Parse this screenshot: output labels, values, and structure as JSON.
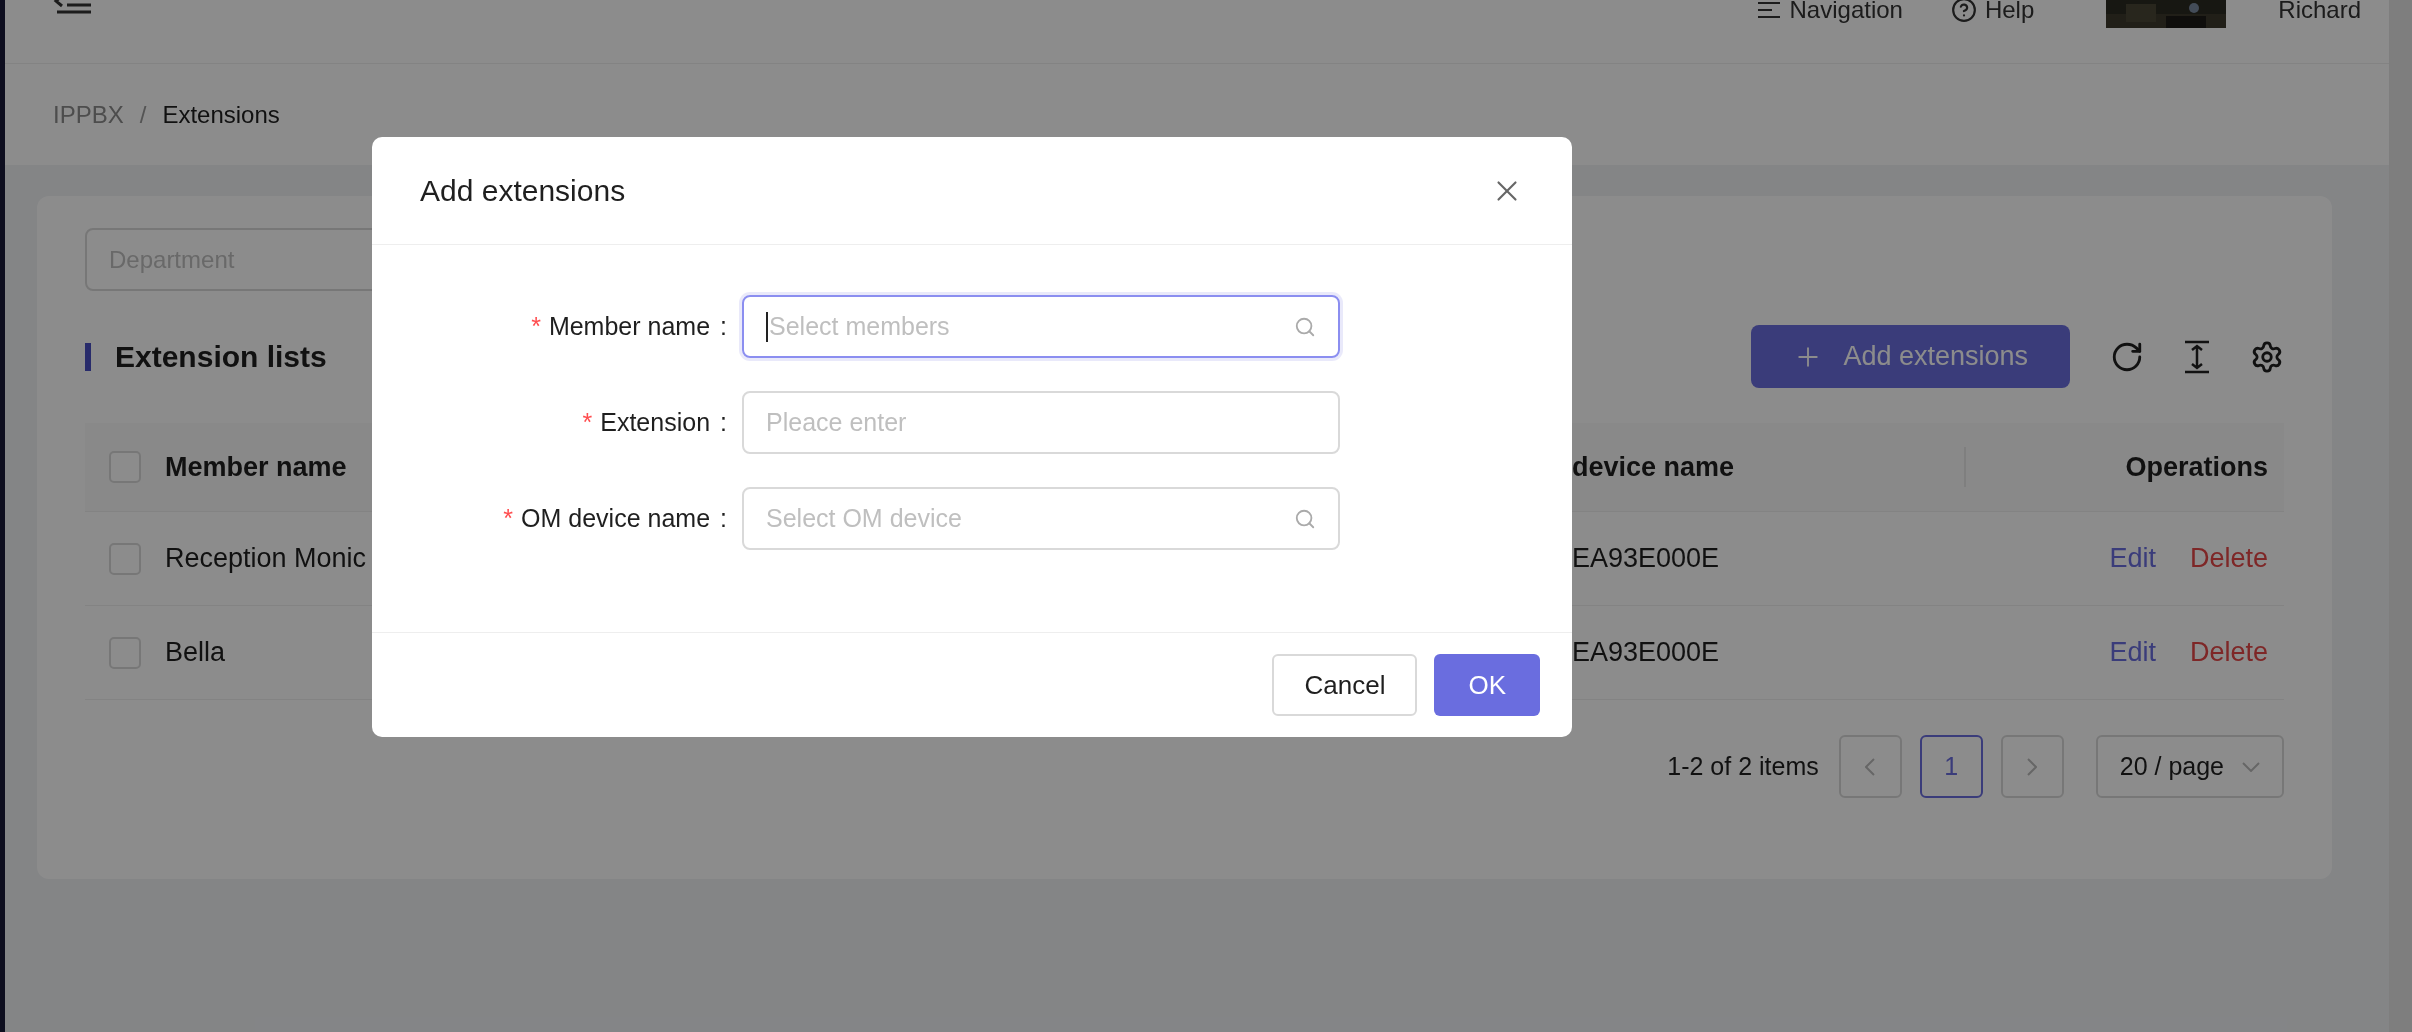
{
  "header": {
    "links": [
      "Navigation",
      "Help"
    ],
    "user": {
      "name": "Richard"
    }
  },
  "breadcrumb": {
    "separator": "/",
    "items": [
      {
        "label": "IPPBX",
        "current": false
      },
      {
        "label": "Extensions",
        "current": true
      }
    ]
  },
  "filters": {
    "department": {
      "placeholder": "Department"
    }
  },
  "section_title": "Extension lists",
  "toolbar": {
    "add_button": "Add extensions"
  },
  "table": {
    "header_checked": false,
    "columns": [
      "Member name",
      "device name",
      "Operations"
    ],
    "rows": [
      {
        "checked": false,
        "member_name": "Reception Monic",
        "device_name": "EA93E000E",
        "actions": [
          "Edit",
          "Delete"
        ]
      },
      {
        "checked": false,
        "member_name": "Bella",
        "device_name": "EA93E000E",
        "actions": [
          "Edit",
          "Delete"
        ]
      }
    ]
  },
  "pagination": {
    "summary": "1-2 of 2 items",
    "pages": [
      {
        "label": "1",
        "selected": true
      }
    ],
    "page_size": "20 / page"
  },
  "dialog": {
    "title": "Add extensions",
    "fields": [
      {
        "label": "Member name",
        "suffix": ":",
        "required_mark": "*",
        "placeholder": "Select members",
        "kind": "search",
        "focused": true
      },
      {
        "label": "Extension",
        "suffix": ":",
        "required_mark": "*",
        "placeholder": "Pleace enter",
        "kind": "text",
        "focused": false
      },
      {
        "label": "OM device name",
        "suffix": ":",
        "required_mark": "*",
        "placeholder": "Select OM device",
        "kind": "search",
        "focused": false
      }
    ],
    "buttons": [
      {
        "label": "Cancel",
        "kind": "default"
      },
      {
        "label": "OK",
        "kind": "primary"
      }
    ]
  }
}
